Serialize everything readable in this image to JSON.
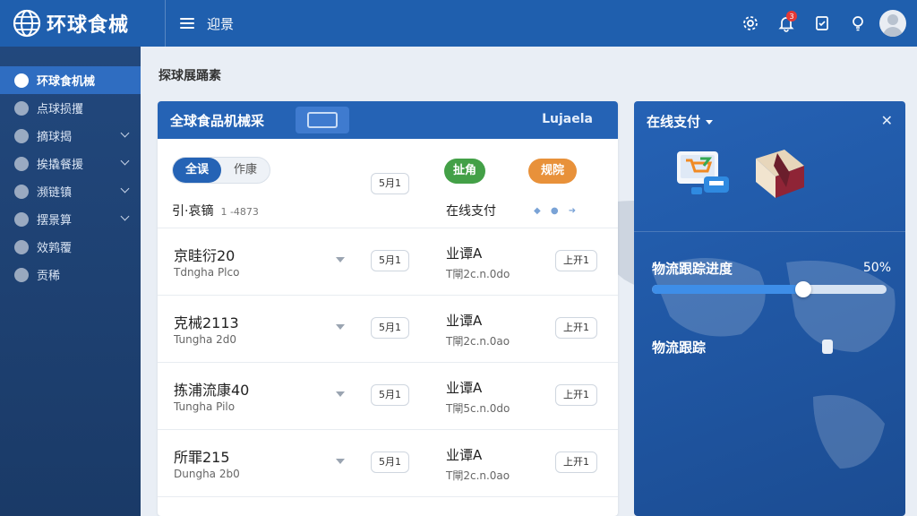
{
  "header": {
    "app_title": "环球食械",
    "menu_label": "迎景",
    "notification_count": "3"
  },
  "sidebar": {
    "items": [
      {
        "label": "环球食机械",
        "active": true,
        "expandable": false
      },
      {
        "label": "点球损攫",
        "active": false,
        "expandable": false
      },
      {
        "label": "摘球揭",
        "active": false,
        "expandable": true
      },
      {
        "label": "挨撬餐援",
        "active": false,
        "expandable": true
      },
      {
        "label": "濒链镇",
        "active": false,
        "expandable": true
      },
      {
        "label": "摆景算",
        "active": false,
        "expandable": true
      },
      {
        "label": "效鹑覆",
        "active": false,
        "expandable": false
      },
      {
        "label": "贡稀",
        "active": false,
        "expandable": false
      }
    ]
  },
  "main": {
    "page_title": "探球展踊素",
    "banner": {
      "title": "全球食品机械采",
      "brand": "Lujaela"
    },
    "toolbar": {
      "seg_active": "全误",
      "seg_other": "作康",
      "btn": "5月1",
      "status_green": "扯角",
      "status_orange": "规院",
      "label": "引·哀镝",
      "label_sub": "1 -4873",
      "pay_label": "在线支付"
    },
    "rows": [
      {
        "name": "京眭衍20",
        "sub": "Tdngha Plco",
        "btn1": "5月1",
        "vendor": "业谭A",
        "vendor_sub": "T閘2c.n.0do",
        "btn2": "上开1"
      },
      {
        "name": "克械2113",
        "sub": "Tungha 2d0",
        "btn1": "5月1",
        "vendor": "业谭A",
        "vendor_sub": "T閘2c.n.0ao",
        "btn2": "上开1"
      },
      {
        "name": "拣浦流康40",
        "sub": "Tungha Pilo",
        "btn1": "5月1",
        "vendor": "业谭A",
        "vendor_sub": "T閘5c.n.0do",
        "btn2": "上开1"
      },
      {
        "name": "所罪215",
        "sub": "Dungha 2b0",
        "btn1": "5月1",
        "vendor": "业谭A",
        "vendor_sub": "T閘2c.n.0ao",
        "btn2": "上开1"
      }
    ]
  },
  "panel": {
    "title": "在线支付",
    "progress_label": "物流跟踪进度",
    "progress_value": 0.5,
    "progress_text": "50%",
    "tracking_label": "物流跟踪"
  },
  "colors": {
    "header": "#1f5fae",
    "accent": "#2563b5",
    "green": "#43a047",
    "orange": "#e8913a"
  }
}
